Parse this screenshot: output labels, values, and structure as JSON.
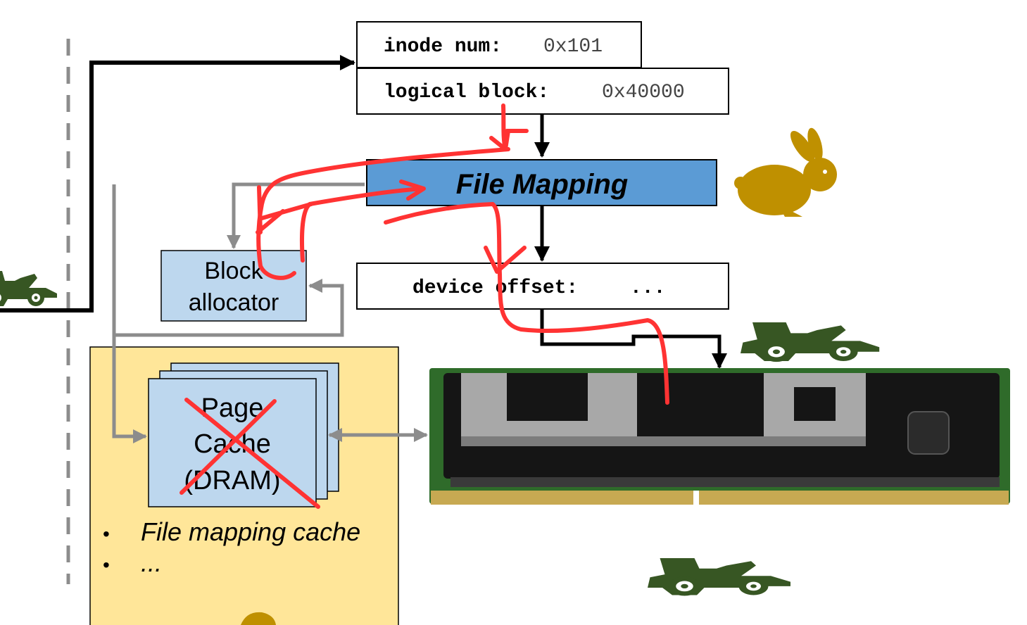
{
  "inode": {
    "label": "inode num:",
    "value": "0x101"
  },
  "logical": {
    "label": "logical block:",
    "value": "0x40000"
  },
  "file_mapping": {
    "label": "File Mapping"
  },
  "device": {
    "label": "device offset:",
    "value": "..."
  },
  "block_allocator": {
    "line1": "Block",
    "line2": "allocator"
  },
  "page_cache": {
    "line1": "Page",
    "line2": "Cache",
    "line3": "(DRAM)"
  },
  "list": {
    "items": [
      "File mapping cache",
      "..."
    ],
    "bullet": "•"
  },
  "icons": [
    "rabbit-icon",
    "race-car-icon",
    "pmem-module-icon"
  ],
  "colors": {
    "file_mapping_fill": "#5b9bd5",
    "light_box_fill": "#bdd7ee",
    "dram_area_fill": "#ffe699",
    "rabbit": "#bf9000",
    "race_car": "#375623",
    "annotation": "#ff3333",
    "gray_arrow": "#8c8c8c"
  }
}
